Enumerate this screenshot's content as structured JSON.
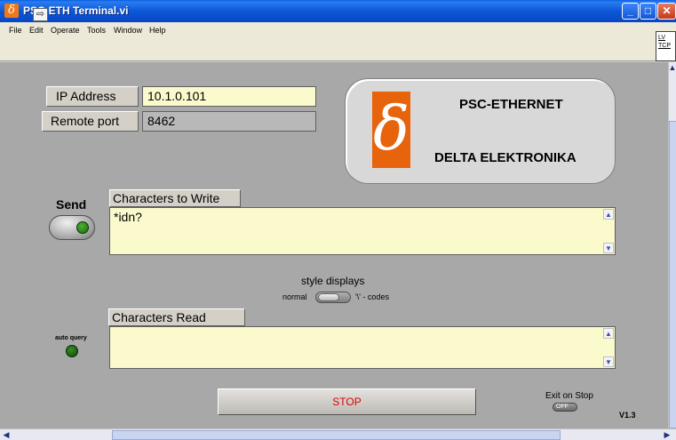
{
  "window": {
    "title": "PSC-ETH Terminal.vi",
    "icon": "delta-icon",
    "controls": {
      "minimize": "_",
      "maximize": "□",
      "close": "✕"
    }
  },
  "menu": [
    "File",
    "Edit",
    "Operate",
    "Tools",
    "Window",
    "Help"
  ],
  "toolbar": {
    "run_glyph": "⇨",
    "lv_icon_line1": "LV",
    "lv_icon_line2": "TCP"
  },
  "connection": {
    "ip_label": "IP Address",
    "ip_value": "10.1.0.101",
    "port_label": "Remote port",
    "port_value": "8462"
  },
  "logo": {
    "symbol": "δ",
    "line1": "PSC-ETHERNET",
    "line2": "DELTA ELEKTRONIKA",
    "accent": "#e8640c"
  },
  "send": {
    "label": "Send"
  },
  "write": {
    "caption": "Characters to Write",
    "value": "*idn?"
  },
  "style_displays": {
    "label": "style displays",
    "left": "normal",
    "right": "'\\' - codes"
  },
  "read": {
    "caption": "Characters Read",
    "value": ""
  },
  "auto_query": {
    "label": "auto query"
  },
  "stop": {
    "label": "STOP",
    "color": "#e00000"
  },
  "exit_on_stop": {
    "label": "Exit on Stop",
    "state": "OFF"
  },
  "version": "V1.3",
  "scroll_arrows": {
    "up": "▲",
    "down": "▼",
    "left": "◀",
    "right": "▶"
  }
}
